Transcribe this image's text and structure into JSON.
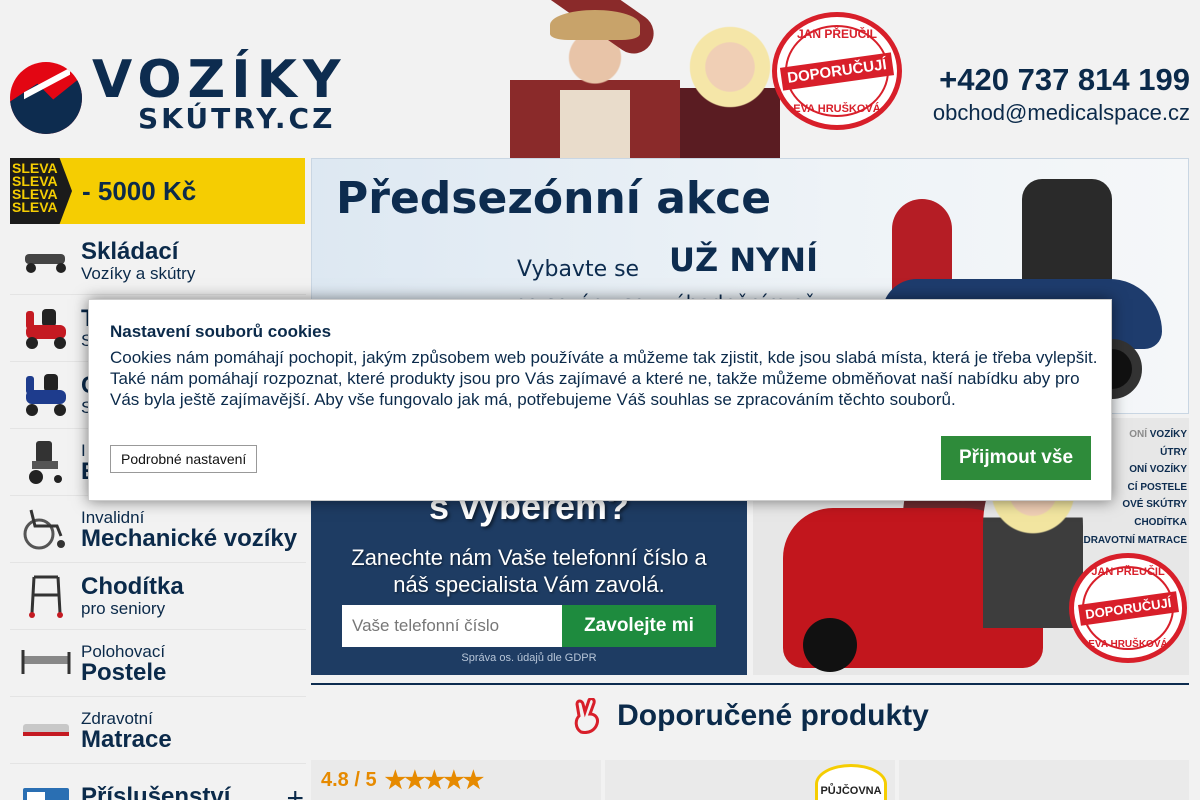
{
  "header": {
    "logo_main": "VOZÍKY",
    "logo_sub": "SKÚTRY.CZ",
    "stamp_top": "JAN PŘEUČIL",
    "stamp_mid": "DOPORUČUJÍ",
    "stamp_bot": "EVA HRUŠKOVÁ",
    "phone": "+420 737 814 199",
    "email": "obchod@medicalspace.cz"
  },
  "sidebar": {
    "promo_tag": [
      "SLEVA",
      "SLEVA",
      "SLEVA",
      "SLEVA"
    ],
    "promo_text": "- 5000 Kč",
    "items": [
      {
        "big": "Skládací",
        "small": "Vozíky a skútry",
        "order": "big-first"
      },
      {
        "big": "T",
        "small": "S",
        "order": "big-first"
      },
      {
        "big": "C",
        "small": "S",
        "order": "big-first"
      },
      {
        "small": "I",
        "big": "E",
        "order": "small-first"
      },
      {
        "small": "Invalidní",
        "big": "Mechanické vozíky",
        "order": "small-first"
      },
      {
        "big": "Chodítka",
        "small": "pro seniory",
        "order": "big-first"
      },
      {
        "small": "Polohovací",
        "big": "Postele",
        "order": "small-first"
      },
      {
        "small": "Zdravotní",
        "big": "Matrace",
        "order": "small-first"
      },
      {
        "big": "Příslušenství",
        "small": "",
        "order": "big-first",
        "plus": "+"
      }
    ]
  },
  "banner": {
    "title": "Předsezónní akce",
    "sub1": "Vybavte se",
    "sub2": "UŽ NYNÍ",
    "sub3": "na sezónu se zvýhodněním až"
  },
  "callbox": {
    "heading": "s výběrem?",
    "text": "Zanechte nám Vaše telefonní číslo a náš specialista Vám zavolá.",
    "placeholder": "Vaše telefonní číslo",
    "button": "Zavolejte mi",
    "gdpr": "Správa os. údajů dle GDPR"
  },
  "people_banner": {
    "list": [
      {
        "muted": "ONÍ",
        "strong": "VOZÍKY"
      },
      {
        "muted": "",
        "strong": "ÚTRY"
      },
      {
        "muted": "",
        "strong": "ONÍ VOZÍKY"
      },
      {
        "muted": "",
        "strong": "CÍ POSTELE"
      },
      {
        "muted": "",
        "strong": "OVÉ SKÚTRY"
      },
      {
        "muted": "",
        "strong": "CHODÍTKA"
      },
      {
        "muted": "",
        "strong": "ZDRAVOTNÍ MATRACE"
      }
    ],
    "stamp_top": "JAN PŘEUČIL",
    "stamp_mid": "DOPORUČUJÍ",
    "stamp_bot": "EVA HRUŠKOVÁ"
  },
  "recommended": {
    "title": "Doporučené produkty",
    "rating": "4.8 / 5",
    "stars": "★★★★★",
    "badge": "PŮJČOVNA"
  },
  "cookie": {
    "title": "Nastavení souborů cookies",
    "text": "Cookies nám pomáhají pochopit, jakým způsobem web používáte a můžeme tak zjistit, kde jsou slabá místa, která je třeba vylepšit. Také nám pomáhají rozpoznat, které produkty jsou pro Vás zajímavé a které ne, takže můžeme obměňovat naší nabídku aby pro Vás byla ještě zajímavější. Aby vše fungovalo jak má, potřebujeme Váš souhlas se zpracováním těchto souborů.",
    "detail_button": "Podrobné nastavení",
    "accept_button": "Přijmout vše"
  },
  "colors": {
    "navy": "#0b2a4a",
    "promo_yellow": "#f5cd02",
    "accept_green": "#2e8b3a",
    "stamp_red": "#d81f2a"
  }
}
